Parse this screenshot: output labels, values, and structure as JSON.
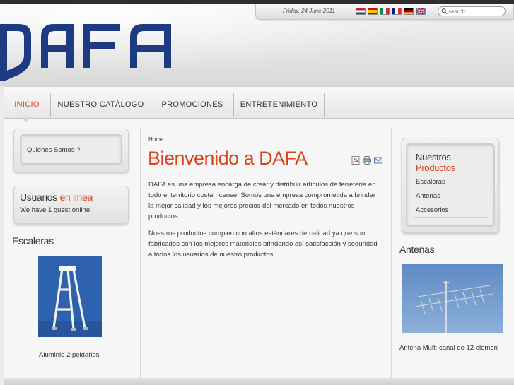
{
  "site": {
    "logo_text": "DAFA"
  },
  "topbar": {
    "date": "Friday, 24 June 2011",
    "languages": [
      "nl",
      "es",
      "it",
      "fr",
      "de",
      "en"
    ],
    "search_placeholder": "search..."
  },
  "nav": {
    "items": [
      {
        "label": "INICIO",
        "active": true
      },
      {
        "label": "NUESTRO CATÁLOGO",
        "active": false
      },
      {
        "label": "PROMOCIONES",
        "active": false
      },
      {
        "label": "ENTRETENIMIENTO",
        "active": false
      }
    ]
  },
  "left": {
    "quienes": "Quienes Somos ?",
    "usuarios_title": "Usuarios",
    "usuarios_highlight": "en linea",
    "usuarios_text": "We have 1 guest online",
    "escaleras_title": "Escaleras",
    "escaleras_caption": "Aluminio 2 peldaños"
  },
  "content": {
    "breadcrumb": "Home",
    "title": "Bienvenido a DAFA",
    "icons": [
      "pdf-icon",
      "print-icon",
      "email-icon"
    ],
    "paragraphs": [
      "DAFA es una empresa encarga de crear y distribuir artículos de ferretería en todo el territorio costarricense. Somos una empresa comprometida a brindar la mejor calidad y los mejores precios del mercado en todos nuestros productos.",
      "Nuestros productos cumplen con altos estándares de calidad ya que son fabricados con los mejores materiales brindando así satisfacción y seguridad a todos los usuarios de nuestro productos."
    ]
  },
  "right": {
    "products_title_1": "Nuestros",
    "products_title_2": "Productos",
    "products": [
      "Escaleras",
      "Antenas",
      "Accesorios"
    ],
    "antenas_title": "Antenas",
    "antenas_caption": "Antena Multi-canal de 12 elemen"
  },
  "colors": {
    "accent": "#d9441d",
    "logo_blue": "#1d3b80"
  }
}
